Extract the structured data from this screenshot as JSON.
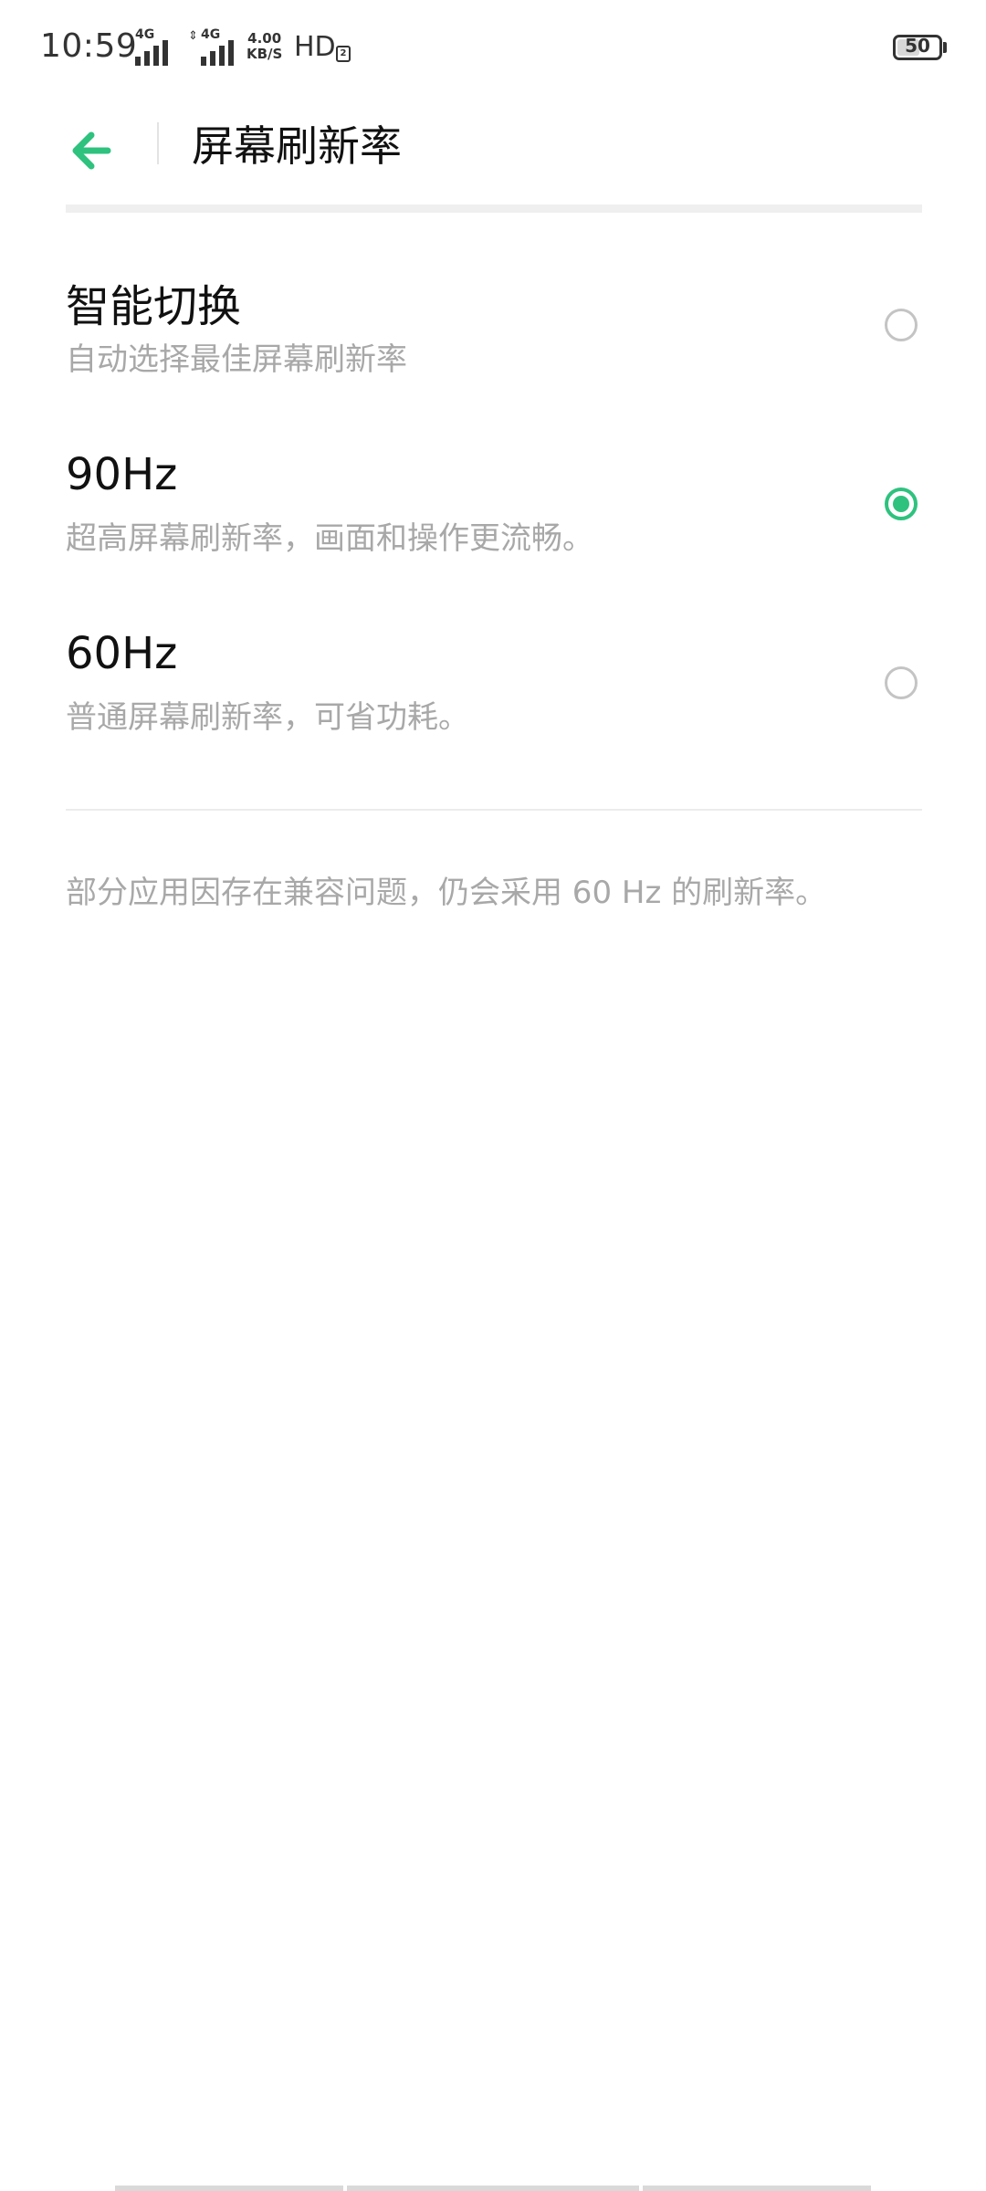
{
  "status_bar": {
    "time": "10:59",
    "sim1_network": "4G",
    "sim2_network": "4G",
    "speed_value": "4.00",
    "speed_unit": "KB/S",
    "hd_label": "HD",
    "hd_sub": "2",
    "battery_level": "50"
  },
  "header": {
    "title": "屏幕刷新率",
    "back_icon": "arrow-left-icon"
  },
  "options": [
    {
      "title": "智能切换",
      "subtitle": "自动选择最佳屏幕刷新率",
      "selected": false
    },
    {
      "title": "90Hz",
      "subtitle": "超高屏幕刷新率，画面和操作更流畅。",
      "selected": true
    },
    {
      "title": "60Hz",
      "subtitle": "普通屏幕刷新率，可省功耗。",
      "selected": false
    }
  ],
  "footnote": "部分应用因存在兼容问题，仍会采用 60 Hz 的刷新率。",
  "colors": {
    "accent": "#2ec27e",
    "title_text": "#111111",
    "secondary_text": "#a8a8a8"
  }
}
